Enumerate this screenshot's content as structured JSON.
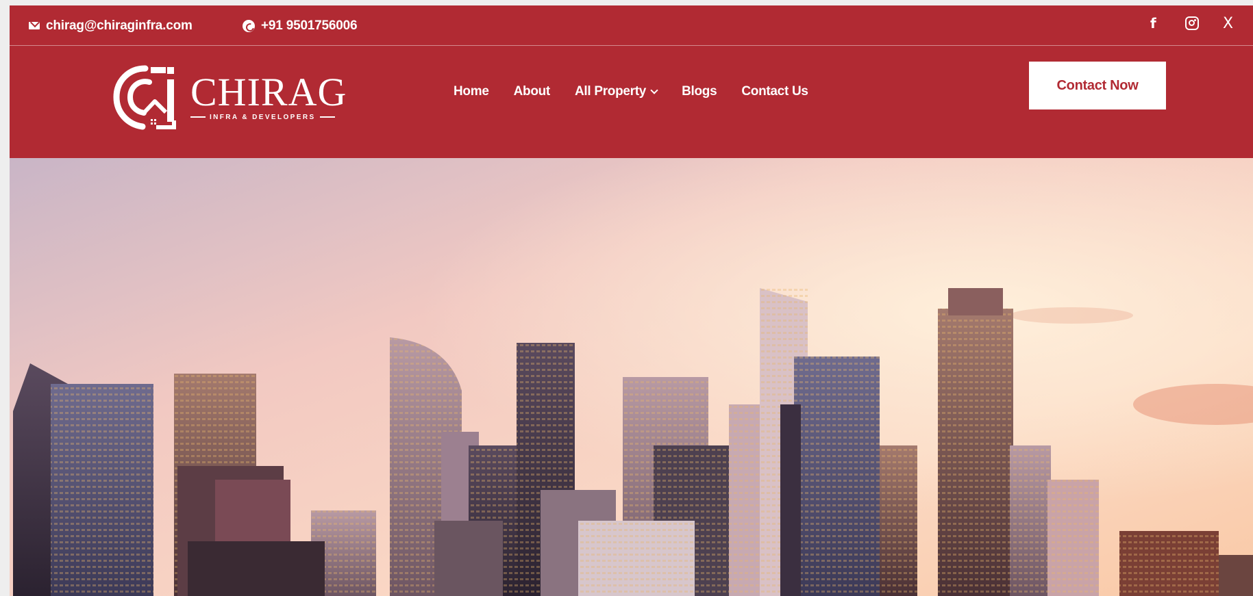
{
  "topbar": {
    "email": "chirag@chiraginfra.com",
    "phone": "+91 9501756006",
    "icons": {
      "email": "mail-icon",
      "phone": "whatsapp-icon",
      "social": [
        "facebook-icon",
        "instagram-icon",
        "x-icon"
      ]
    },
    "facebook_glyph": "f",
    "x_glyph": "X"
  },
  "header": {
    "logo": {
      "name": "CHIRAG",
      "tagline": "INFRA & DEVELOPERS"
    },
    "nav": [
      {
        "label": "Home"
      },
      {
        "label": "About"
      },
      {
        "label": "All Property"
      },
      {
        "label": "Blogs"
      },
      {
        "label": "Contact Us"
      }
    ],
    "cta_label": "Contact Now"
  },
  "hero": {
    "image": "city-skyline-at-sunset"
  },
  "colors": {
    "brand": "#b12a33",
    "text_on_brand": "#ffffff"
  }
}
